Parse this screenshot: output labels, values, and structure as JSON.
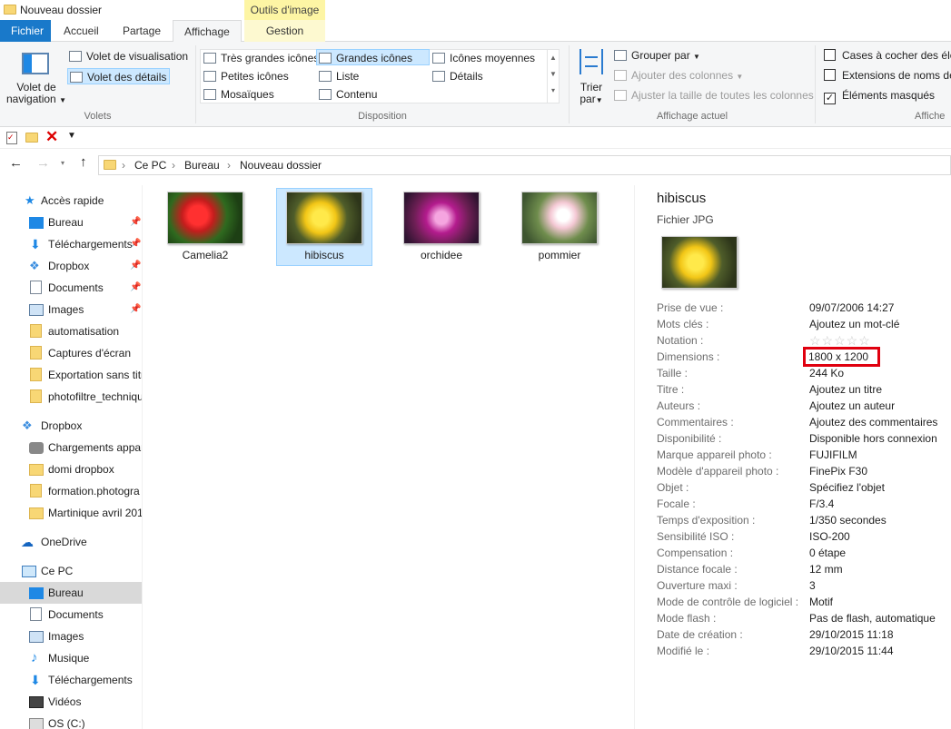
{
  "window": {
    "title": "Nouveau dossier"
  },
  "context_tab": {
    "header": "Outils d'image",
    "label": "Gestion"
  },
  "tabs": [
    "Fichier",
    "Accueil",
    "Partage",
    "Affichage"
  ],
  "ribbon": {
    "volets": {
      "nav_pane_line1": "Volet de",
      "nav_pane_line2": "navigation",
      "preview": "Volet de visualisation",
      "details": "Volet des détails",
      "group": "Volets"
    },
    "disposition": {
      "items": [
        "Très grandes icônes",
        "Grandes icônes",
        "Icônes moyennes",
        "Petites icônes",
        "Liste",
        "Détails",
        "Mosaïques",
        "Contenu"
      ],
      "group": "Disposition"
    },
    "affichage_actuel": {
      "sort_line1": "Trier",
      "sort_line2": "par",
      "group_by": "Grouper par",
      "add_columns": "Ajouter des colonnes",
      "fit_columns": "Ajuster la taille de toutes les colonnes",
      "group": "Affichage actuel"
    },
    "afficher": {
      "checkboxes": "Cases à cocher des élém",
      "extensions": "Extensions de noms de",
      "hidden": "Éléments masqués",
      "group": "Affiche"
    }
  },
  "address": {
    "crumbs": [
      "Ce PC",
      "Bureau",
      "Nouveau dossier"
    ]
  },
  "nav": {
    "quick_access": "Accès rapide",
    "quick_items": [
      "Bureau",
      "Téléchargements",
      "Dropbox",
      "Documents",
      "Images",
      "automatisation",
      "Captures d'écran",
      "Exportation sans titr",
      "photofiltre_techniqu"
    ],
    "dropbox": "Dropbox",
    "dropbox_items": [
      "Chargements appar",
      "domi dropbox",
      "formation.photogra",
      "Martinique avril 201"
    ],
    "onedrive": "OneDrive",
    "this_pc": "Ce PC",
    "pc_items": [
      "Bureau",
      "Documents",
      "Images",
      "Musique",
      "Téléchargements",
      "Vidéos",
      "OS (C:)"
    ]
  },
  "files": [
    "Camelia2",
    "hibiscus",
    "orchidee",
    "pommier"
  ],
  "details": {
    "name": "hibiscus",
    "type": "Fichier JPG",
    "stars": "☆☆☆☆☆",
    "props": [
      [
        "Prise de vue :",
        "09/07/2006 14:27"
      ],
      [
        "Mots clés :",
        "Ajoutez un mot-clé"
      ],
      [
        "Notation :",
        ""
      ],
      [
        "Dimensions :",
        "1800 x 1200"
      ],
      [
        "Taille :",
        "244 Ko"
      ],
      [
        "Titre :",
        "Ajoutez un titre"
      ],
      [
        "Auteurs :",
        "Ajoutez un auteur"
      ],
      [
        "Commentaires :",
        "Ajoutez des commentaires"
      ],
      [
        "Disponibilité :",
        "Disponible hors connexion"
      ],
      [
        "Marque appareil photo :",
        "FUJIFILM"
      ],
      [
        "Modèle d'appareil photo :",
        "FinePix F30"
      ],
      [
        "Objet :",
        "Spécifiez l'objet"
      ],
      [
        "Focale :",
        "F/3.4"
      ],
      [
        "Temps d'exposition :",
        "1/350 secondes"
      ],
      [
        "Sensibilité ISO :",
        "ISO-200"
      ],
      [
        "Compensation :",
        "0 étape"
      ],
      [
        "Distance focale :",
        "12 mm"
      ],
      [
        "Ouverture maxi :",
        "3"
      ],
      [
        "Mode de contrôle de logiciel :",
        "Motif"
      ],
      [
        "Mode flash :",
        "Pas de flash, automatique"
      ],
      [
        "Date de création :",
        "29/10/2015 11:18"
      ],
      [
        "Modifié le :",
        "29/10/2015 11:44"
      ]
    ]
  },
  "colors": {
    "accent": "#1979ca",
    "selection": "#cce8ff",
    "highlight_box": "#e0000f"
  }
}
